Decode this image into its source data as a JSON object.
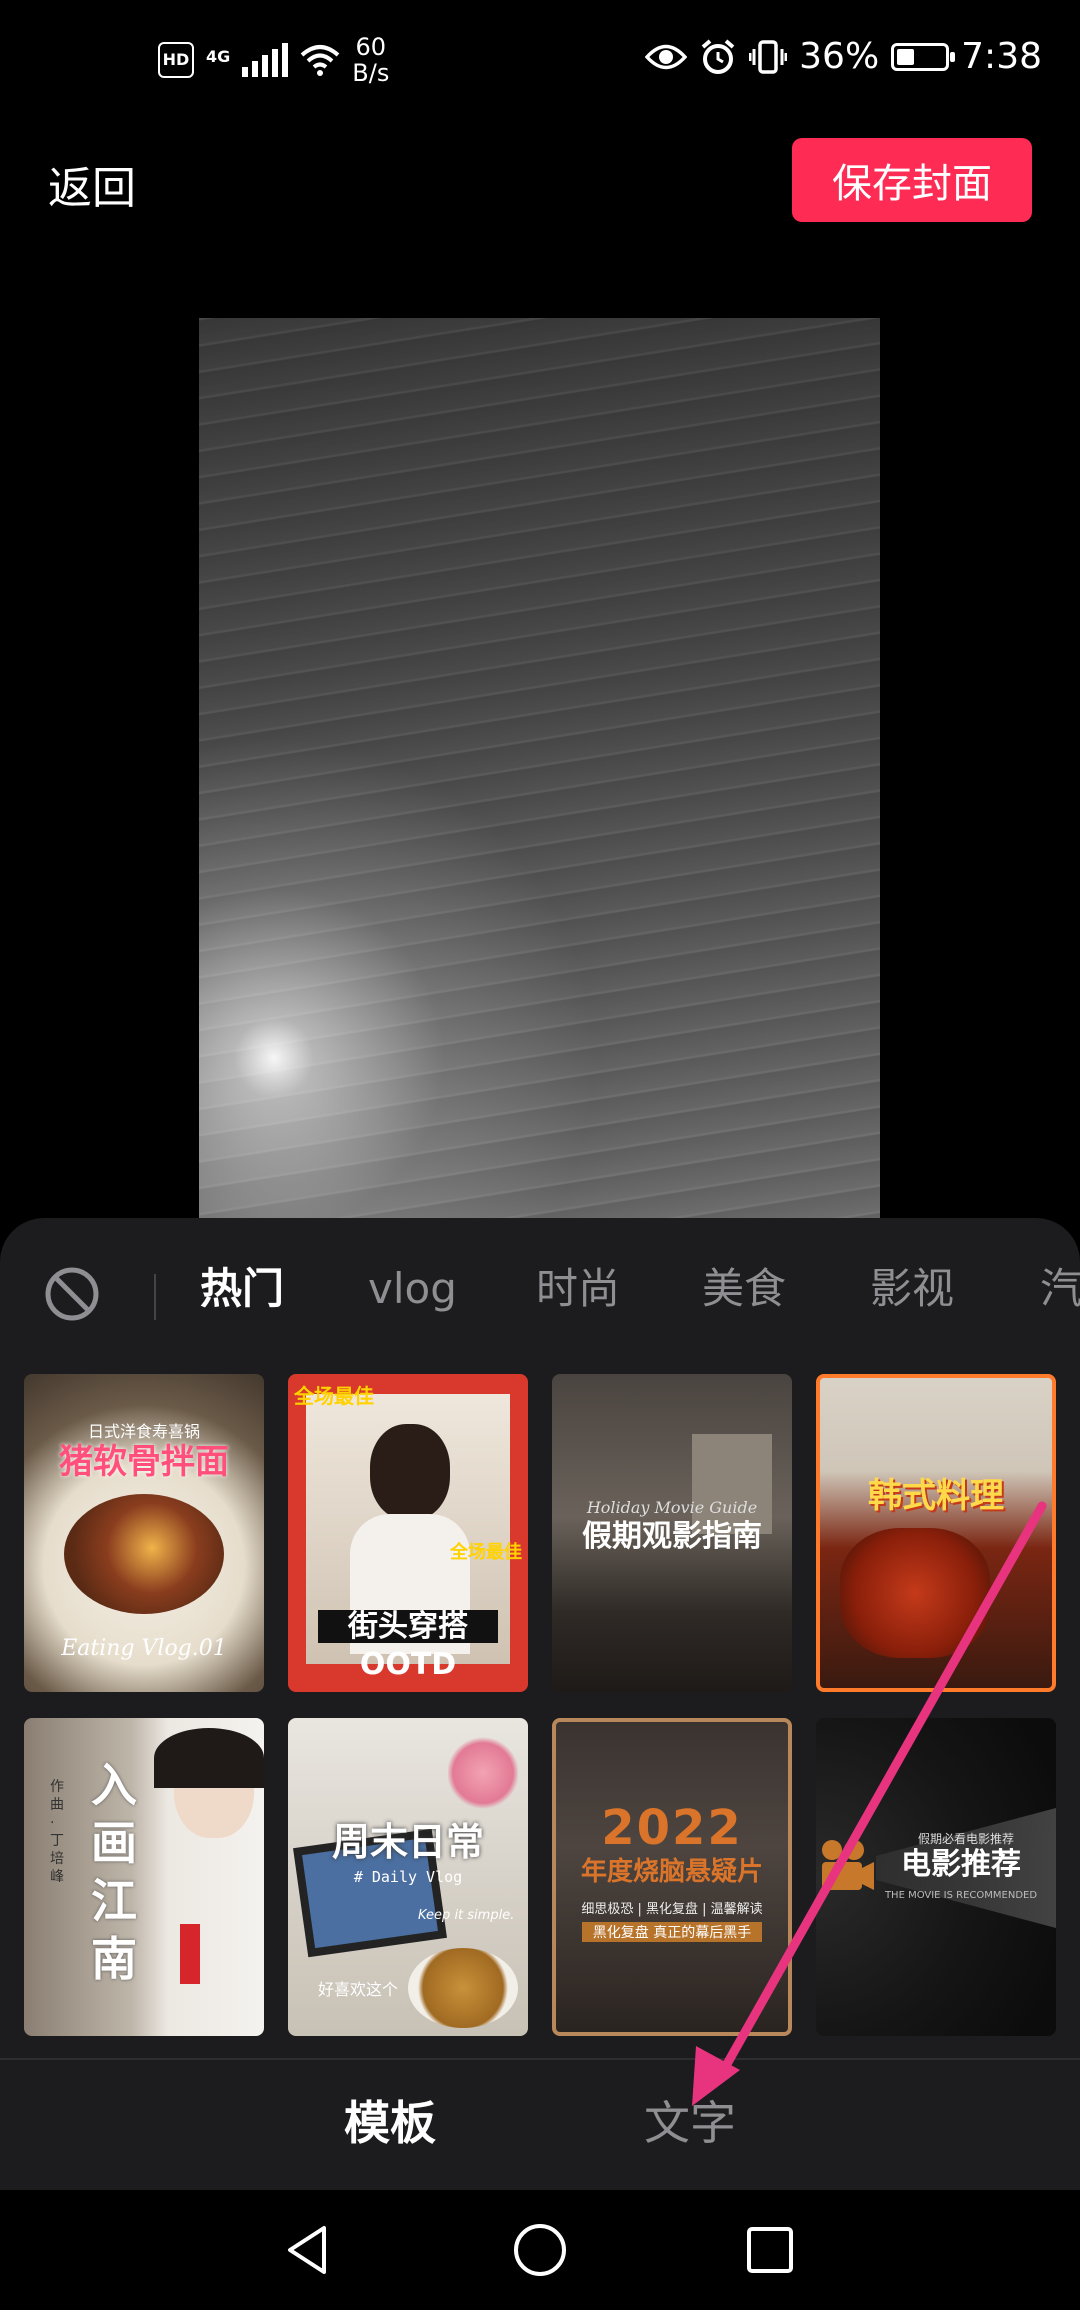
{
  "status_bar": {
    "hd": "HD",
    "network": "4G",
    "speed_value": "60",
    "speed_unit": "B/s",
    "battery_percent": "36%",
    "battery_level": 0.36,
    "time": "7:38"
  },
  "top_bar": {
    "back_label": "返回",
    "save_label": "保存封面",
    "save_color": "#fe2c55"
  },
  "categories": {
    "none_icon": "no-style-icon",
    "items": [
      "热门",
      "vlog",
      "时尚",
      "美食",
      "影视",
      "汽"
    ],
    "active_index": 0
  },
  "templates": [
    {
      "title": "猪软骨拌面",
      "subtitle": "日式洋食寿喜锅",
      "caption": "Eating Vlog.01"
    },
    {
      "title": "街头穿搭",
      "title2": "OOTD",
      "badge": "全场最佳",
      "badge2": "全场最佳"
    },
    {
      "title": "假期观影指南",
      "subtitle": "Holiday Movie Guide"
    },
    {
      "title": "韩式料理"
    },
    {
      "title": "入画江南",
      "subtitle": "作曲 · 丁培峰"
    },
    {
      "title": "周末日常",
      "subtitle": "# Daily Vlog",
      "caption": "Keep it simple.",
      "note": "好喜欢这个"
    },
    {
      "title": "2022",
      "title2": "年度烧脑悬疑片",
      "subtitle": "细思极恐 | 黑化复盘 | 温馨解读",
      "caption": "黑化复盘 真正的幕后黑手"
    },
    {
      "title": "电影推荐",
      "subtitle": "假期必看电影推荐",
      "caption": "THE MOVIE IS RECOMMENDED"
    }
  ],
  "bottom_tabs": {
    "template_label": "模板",
    "text_label": "文字"
  },
  "annotation": {
    "arrow_color": "#e8337f"
  }
}
